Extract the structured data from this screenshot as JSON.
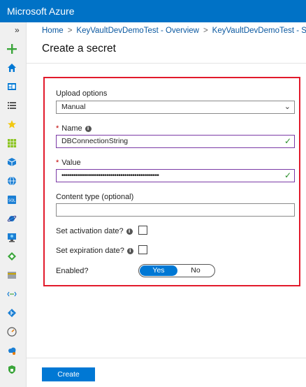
{
  "app": {
    "title": "Microsoft Azure"
  },
  "sidebar": {
    "expand_glyph": "»",
    "icons": [
      "plus-icon",
      "home-icon",
      "dashboard-icon",
      "list-icon",
      "star-icon",
      "grid-icon",
      "cube-icon",
      "globe-icon",
      "sql-icon",
      "planet-icon",
      "monitor-icon",
      "diamond-icon",
      "card-icon",
      "dots-icon",
      "git-icon",
      "gauge-icon",
      "cloud-icon",
      "shield-icon"
    ]
  },
  "breadcrumb": {
    "items": [
      "Home",
      "KeyVaultDevDemoTest - Overview",
      "KeyVaultDevDemoTest - Secre"
    ],
    "separator": ">"
  },
  "blade": {
    "title": "Create a secret"
  },
  "form": {
    "upload_options": {
      "label": "Upload options",
      "value": "Manual"
    },
    "name": {
      "label": "Name",
      "value": "DBConnectionString"
    },
    "value": {
      "label": "Value",
      "masked": "••••••••••••••••••••••••••••••••••••••••••••••••"
    },
    "content_type": {
      "label": "Content type (optional)",
      "value": ""
    },
    "activation": {
      "label": "Set activation date?"
    },
    "expiration": {
      "label": "Set expiration date?"
    },
    "enabled": {
      "label": "Enabled?",
      "yes": "Yes",
      "no": "No",
      "selected": "Yes"
    }
  },
  "footer": {
    "create_label": "Create"
  },
  "colors": {
    "brand": "#0072c6",
    "primary_button": "#0078d4",
    "highlight_border": "#e21a2b",
    "valid_border": "#7b3aa6"
  }
}
